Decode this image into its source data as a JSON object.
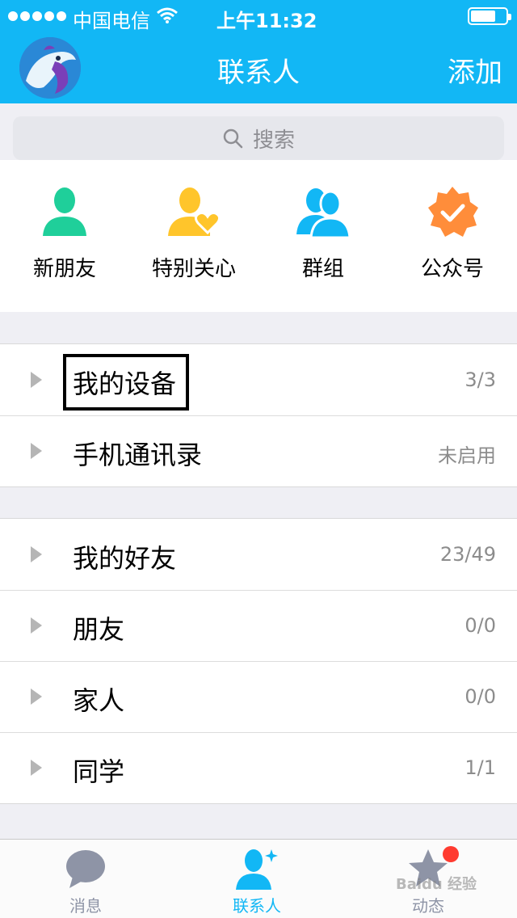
{
  "status_bar": {
    "carrier": "中国电信",
    "time": "上午11:32"
  },
  "nav": {
    "title": "联系人",
    "add_label": "添加"
  },
  "search": {
    "placeholder": "搜索"
  },
  "quick_actions": [
    {
      "label": "新朋友",
      "icon": "person-icon",
      "color": "#1fcf9a"
    },
    {
      "label": "特别关心",
      "icon": "person-heart-icon",
      "color": "#ffc52b"
    },
    {
      "label": "群组",
      "icon": "group-icon",
      "color": "#12b7f5"
    },
    {
      "label": "公众号",
      "icon": "verified-badge-icon",
      "color": "#ff8d3a"
    }
  ],
  "device_group": [
    {
      "label": "我的设备",
      "count": "3/3"
    },
    {
      "label": "手机通讯录",
      "count": "未启用"
    }
  ],
  "friend_groups": [
    {
      "label": "我的好友",
      "count": "23/49"
    },
    {
      "label": "朋友",
      "count": "0/0"
    },
    {
      "label": "家人",
      "count": "0/0"
    },
    {
      "label": "同学",
      "count": "1/1"
    }
  ],
  "tabs": [
    {
      "label": "消息",
      "icon": "chat-bubble-icon",
      "active": false
    },
    {
      "label": "联系人",
      "icon": "contacts-icon",
      "active": true
    },
    {
      "label": "动态",
      "icon": "star-icon",
      "active": false
    }
  ],
  "watermark": "Baidu 经验",
  "colors": {
    "accent": "#12b7f5",
    "inactive_tab": "#8e94a6",
    "badge": "#ff3b30"
  }
}
